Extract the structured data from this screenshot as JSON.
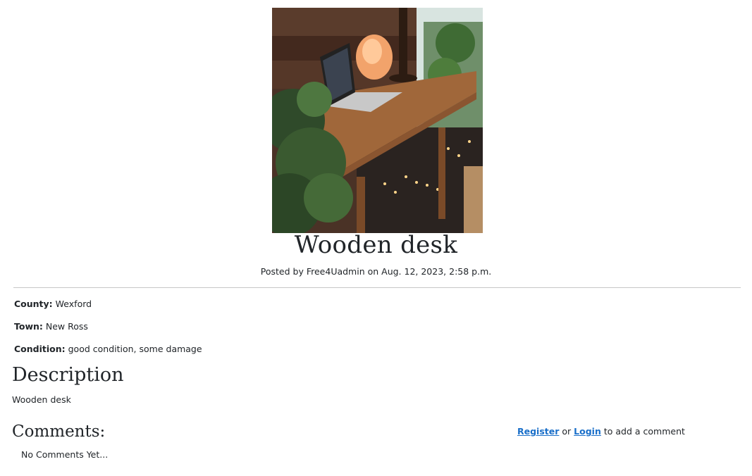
{
  "post": {
    "title": "Wooden desk",
    "byline": "Posted by Free4Uadmin on Aug. 12, 2023, 2:58 p.m.",
    "fields": [
      {
        "label": "County:",
        "value": "Wexford"
      },
      {
        "label": "Town:",
        "value": "New Ross"
      },
      {
        "label": "Condition:",
        "value": "good condition, some damage"
      }
    ],
    "description_heading": "Description",
    "description": "Wooden desk"
  },
  "comments": {
    "heading": "Comments:",
    "empty_text": "No Comments Yet...",
    "register_label": "Register",
    "or_text": "or",
    "login_label": "Login",
    "suffix_text": "to add a comment"
  }
}
